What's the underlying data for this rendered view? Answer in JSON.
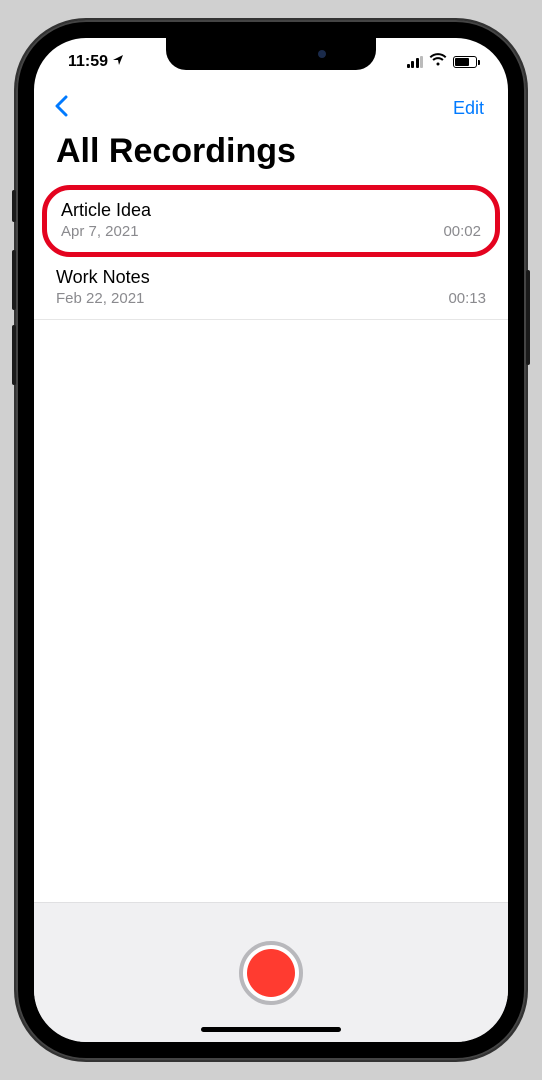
{
  "status": {
    "time": "11:59"
  },
  "nav": {
    "edit_label": "Edit"
  },
  "page": {
    "title": "All Recordings"
  },
  "recordings": [
    {
      "title": "Article Idea",
      "date": "Apr 7, 2021",
      "duration": "00:02"
    },
    {
      "title": "Work Notes",
      "date": "Feb 22, 2021",
      "duration": "00:13"
    }
  ]
}
